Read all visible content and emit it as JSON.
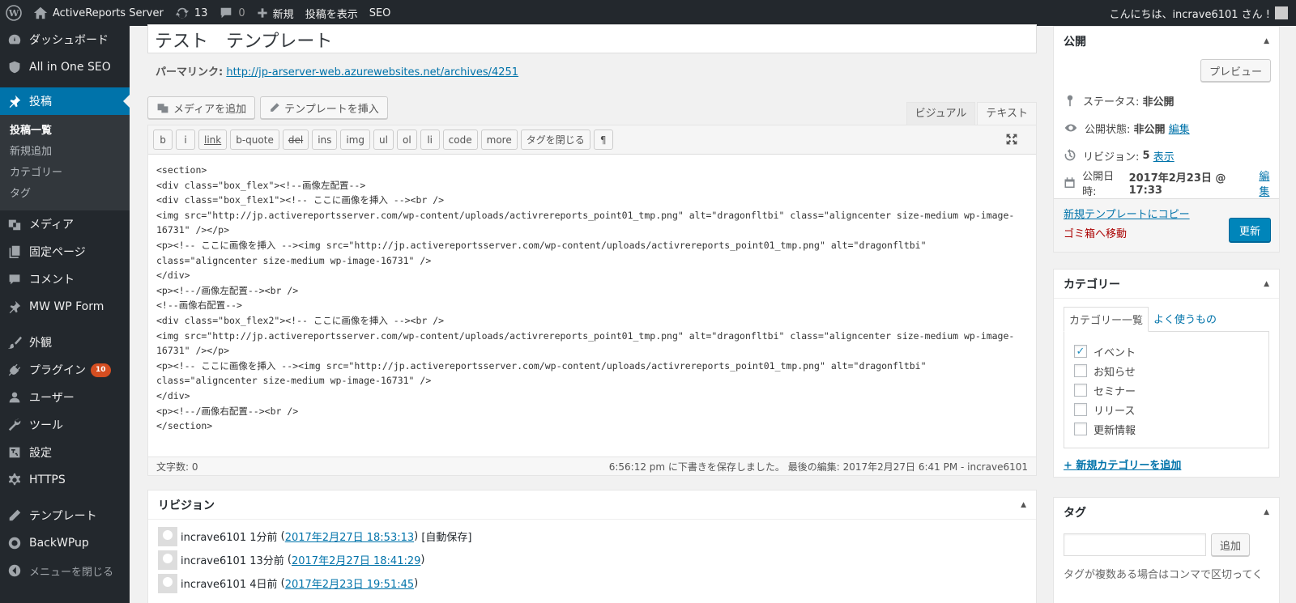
{
  "adminbar": {
    "site_name": "ActiveReports Server",
    "updates": "13",
    "comments": "0",
    "new_label": "新規",
    "view_post": "投稿を表示",
    "seo": "SEO",
    "greeting": "こんにちは、incrave6101 さん !"
  },
  "sidebar": {
    "dashboard": "ダッシュボード",
    "aioseo": "All in One SEO",
    "posts": "投稿",
    "sub_all": "投稿一覧",
    "sub_new": "新規追加",
    "sub_cat": "カテゴリー",
    "sub_tag": "タグ",
    "media": "メディア",
    "pages": "固定ページ",
    "comments": "コメント",
    "mwwp": "MW WP Form",
    "appearance": "外観",
    "plugins": "プラグイン",
    "plugins_badge": "10",
    "users": "ユーザー",
    "tools": "ツール",
    "settings": "設定",
    "https": "HTTPS",
    "template": "テンプレート",
    "backwpup": "BackWPup",
    "collapse": "メニューを閉じる"
  },
  "editor": {
    "title": "テスト　テンプレート",
    "permalink_label": "パーマリンク:",
    "permalink_url": "http://jp-arserver-web.azurewebsites.net/archives/4251",
    "add_media": "メディアを追加",
    "insert_template": "テンプレートを挿入",
    "tab_visual": "ビジュアル",
    "tab_text": "テキスト",
    "qt": [
      "b",
      "i",
      "link",
      "b-quote",
      "del",
      "ins",
      "img",
      "ul",
      "ol",
      "li",
      "code",
      "more",
      "タグを閉じる",
      "¶"
    ],
    "content": "<section>\n<div class=\"box_flex\"><!--画像左配置-->\n<div class=\"box_flex1\"><!-- ここに画像を挿入 --><br />\n<img src=\"http://jp.activereportsserver.com/wp-content/uploads/activrereports_point01_tmp.png\" alt=\"dragonfltbi\" class=\"aligncenter size-medium wp-image-16731\" /></p>\n<p><!-- ここに画像を挿入 --><img src=\"http://jp.activereportsserver.com/wp-content/uploads/activrereports_point01_tmp.png\" alt=\"dragonfltbi\" class=\"aligncenter size-medium wp-image-16731\" />\n</div>\n<p><!--/画像左配置--><br />\n<!--画像右配置-->\n<div class=\"box_flex2\"><!-- ここに画像を挿入 --><br />\n<img src=\"http://jp.activereportsserver.com/wp-content/uploads/activrereports_point01_tmp.png\" alt=\"dragonfltbi\" class=\"aligncenter size-medium wp-image-16731\" /></p>\n<p><!-- ここに画像を挿入 --><img src=\"http://jp.activereportsserver.com/wp-content/uploads/activrereports_point01_tmp.png\" alt=\"dragonfltbi\" class=\"aligncenter size-medium wp-image-16731\" />\n</div>\n<p><!--/画像右配置--><br />\n</section>",
    "word_count": "文字数: 0",
    "save_status": "6:56:12 pm に下書きを保存しました。 最後の編集: 2017年2月27日 6:41 PM - incrave6101"
  },
  "revisions": {
    "title": "リビジョン",
    "items": [
      {
        "author": "incrave6101 1分前",
        "date": "2017年2月27日 18:53:13",
        "note": "[自動保存]"
      },
      {
        "author": "incrave6101 13分前",
        "date": "2017年2月27日 18:41:29",
        "note": ""
      },
      {
        "author": "incrave6101 4日前",
        "date": "2017年2月23日 19:51:45",
        "note": ""
      }
    ]
  },
  "publish": {
    "title": "公開",
    "preview": "プレビュー",
    "status_label": "ステータス:",
    "status_value": "非公開",
    "visibility_label": "公開状態:",
    "visibility_value": "非公開",
    "edit": "編集",
    "revisions_label": "リビジョン:",
    "revisions_value": "5",
    "show": "表示",
    "date_label": "公開日時:",
    "date_value": "2017年2月23日 @ 17:33",
    "copy_link": "新規テンプレートにコピー",
    "trash": "ゴミ箱へ移動",
    "update": "更新"
  },
  "categories": {
    "title": "カテゴリー",
    "tab_all": "カテゴリー一覧",
    "tab_popular": "よく使うもの",
    "items": [
      {
        "label": "イベント",
        "checked": true
      },
      {
        "label": "お知らせ",
        "checked": false
      },
      {
        "label": "セミナー",
        "checked": false
      },
      {
        "label": "リリース",
        "checked": false
      },
      {
        "label": "更新情報",
        "checked": false
      }
    ],
    "add_new": "+ 新規カテゴリーを追加"
  },
  "tags": {
    "title": "タグ",
    "add": "追加",
    "help": "タグが複数ある場合はコンマで区切ってく"
  },
  "colors": {
    "adminbar": "#23282d",
    "accent": "#0073aa",
    "primary_button": "#0085ba",
    "trash": "#a00",
    "badge": "#d54e21"
  }
}
